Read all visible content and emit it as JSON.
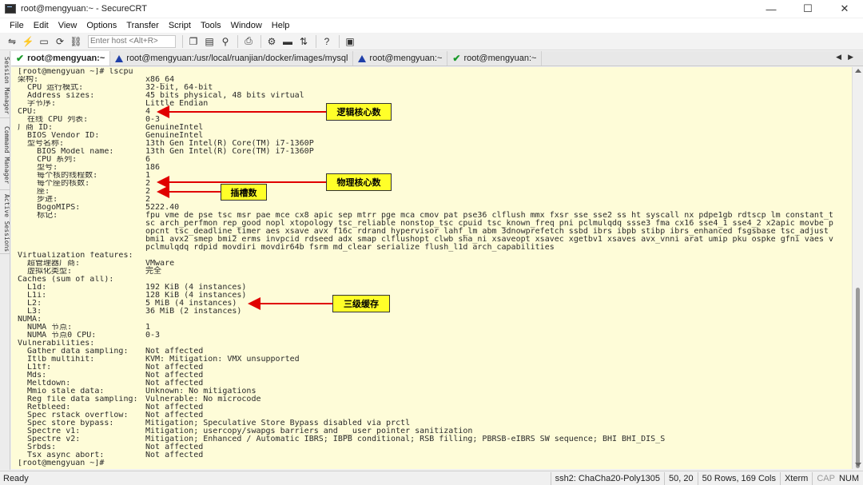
{
  "window": {
    "title": "root@mengyuan:~ - SecureCRT",
    "minimize": "—",
    "maximize": "☐",
    "close": "✕"
  },
  "menu": [
    "File",
    "Edit",
    "View",
    "Options",
    "Transfer",
    "Script",
    "Tools",
    "Window",
    "Help"
  ],
  "toolbar": {
    "host_placeholder": "Enter host <Alt+R>"
  },
  "sidebar": {
    "session_manager": "Session Manager",
    "command_manager": "Command Manager",
    "active_sessions": "Active Sessions"
  },
  "tabs": [
    {
      "label": "root@mengyuan:~",
      "status": "connected",
      "active": true
    },
    {
      "label": "root@mengyuan:/usr/local/ruanjian/docker/images/mysql",
      "status": "warning",
      "active": false
    },
    {
      "label": "root@mengyuan:~",
      "status": "warning",
      "active": false
    },
    {
      "label": "root@mengyuan:~",
      "status": "connected",
      "active": false
    }
  ],
  "terminal": {
    "lines": [
      {
        "k": "[root@mengyuan ~]# lscpu",
        "v": ""
      },
      {
        "k": "架构:",
        "v": "x86_64"
      },
      {
        "k": "  CPU 运行模式:",
        "v": "32-bit, 64-bit"
      },
      {
        "k": "  Address sizes:",
        "v": "45 bits physical, 48 bits virtual"
      },
      {
        "k": "  字节序:",
        "v": "Little Endian"
      },
      {
        "k": "CPU:",
        "v": "4"
      },
      {
        "k": "  在线 CPU 列表:",
        "v": "0-3"
      },
      {
        "k": "厂商 ID:",
        "v": "GenuineIntel"
      },
      {
        "k": "  BIOS Vendor ID:",
        "v": "GenuineIntel"
      },
      {
        "k": "  型号名称:",
        "v": "13th Gen Intel(R) Core(TM) i7-1360P"
      },
      {
        "k": "    BIOS Model name:",
        "v": "13th Gen Intel(R) Core(TM) i7-1360P"
      },
      {
        "k": "    CPU 系列:",
        "v": "6"
      },
      {
        "k": "    型号:",
        "v": "186"
      },
      {
        "k": "    每个核的线程数:",
        "v": "1"
      },
      {
        "k": "    每个座的核数:",
        "v": "2"
      },
      {
        "k": "    座:",
        "v": "2"
      },
      {
        "k": "    步进:",
        "v": "2"
      },
      {
        "k": "    BogoMIPS:",
        "v": "5222.40"
      },
      {
        "k": "    标记:",
        "v": "fpu vme de pse tsc msr pae mce cx8 apic sep mtrr pge mca cmov pat pse36 clflush mmx fxsr sse sse2 ss ht syscall nx pdpe1gb rdtscp lm constant_t"
      },
      {
        "k": "",
        "v": "sc arch_perfmon rep_good nopl xtopology tsc_reliable nonstop_tsc cpuid tsc_known_freq pni pclmulqdq ssse3 fma cx16 sse4_1 sse4_2 x2apic movbe p"
      },
      {
        "k": "",
        "v": "opcnt tsc_deadline_timer aes xsave avx f16c rdrand hypervisor lahf_lm abm 3dnowprefetch ssbd ibrs ibpb stibp ibrs_enhanced fsgsbase tsc_adjust"
      },
      {
        "k": "",
        "v": "bmi1 avx2 smep bmi2 erms invpcid rdseed adx smap clflushopt clwb sha_ni xsaveopt xsavec xgetbv1 xsaves avx_vnni arat umip pku ospke gfni vaes v"
      },
      {
        "k": "",
        "v": "pclmulqdq rdpid movdiri movdir64b fsrm md_clear serialize flush_l1d arch_capabilities"
      },
      {
        "k": "Virtualization features:",
        "v": ""
      },
      {
        "k": "  超管理器厂商:",
        "v": "VMware"
      },
      {
        "k": "  虚拟化类型:",
        "v": "完全"
      },
      {
        "k": "Caches (sum of all):",
        "v": ""
      },
      {
        "k": "  L1d:",
        "v": "192 KiB (4 instances)"
      },
      {
        "k": "  L1i:",
        "v": "128 KiB (4 instances)"
      },
      {
        "k": "  L2:",
        "v": "5 MiB (4 instances)"
      },
      {
        "k": "  L3:",
        "v": "36 MiB (2 instances)"
      },
      {
        "k": "NUMA:",
        "v": ""
      },
      {
        "k": "  NUMA 节点:",
        "v": "1"
      },
      {
        "k": "  NUMA 节点0 CPU:",
        "v": "0-3"
      },
      {
        "k": "Vulnerabilities:",
        "v": ""
      },
      {
        "k": "  Gather data sampling:",
        "v": "Not affected"
      },
      {
        "k": "  Itlb multihit:",
        "v": "KVM: Mitigation: VMX unsupported"
      },
      {
        "k": "  L1tf:",
        "v": "Not affected"
      },
      {
        "k": "  Mds:",
        "v": "Not affected"
      },
      {
        "k": "  Meltdown:",
        "v": "Not affected"
      },
      {
        "k": "  Mmio stale data:",
        "v": "Unknown: No mitigations"
      },
      {
        "k": "  Reg file data sampling:",
        "v": "Vulnerable: No microcode"
      },
      {
        "k": "  Retbleed:",
        "v": "Not affected"
      },
      {
        "k": "  Spec rstack overflow:",
        "v": "Not affected"
      },
      {
        "k": "  Spec store bypass:",
        "v": "Mitigation; Speculative Store Bypass disabled via prctl"
      },
      {
        "k": "  Spectre v1:",
        "v": "Mitigation; usercopy/swapgs barriers and __user pointer sanitization"
      },
      {
        "k": "  Spectre v2:",
        "v": "Mitigation; Enhanced / Automatic IBRS; IBPB conditional; RSB filling; PBRSB-eIBRS SW sequence; BHI BHI_DIS_S"
      },
      {
        "k": "  Srbds:",
        "v": "Not affected"
      },
      {
        "k": "  Tsx async abort:",
        "v": "Not affected"
      },
      {
        "k": "[root@mengyuan ~]# ",
        "v": ""
      }
    ]
  },
  "annotations": {
    "logical_cores": "逻辑核心数",
    "physical_cores": "物理核心数",
    "sockets": "插槽数",
    "l3_cache": "三级缓存",
    "color": "#ffff29",
    "arrow_color": "#e00000"
  },
  "status": {
    "ready": "Ready",
    "cipher": "ssh2: ChaCha20-Poly1305",
    "cursor": "50,  20",
    "size": "50 Rows, 169 Cols",
    "term": "Xterm",
    "cap": "CAP",
    "num": "NUM"
  }
}
